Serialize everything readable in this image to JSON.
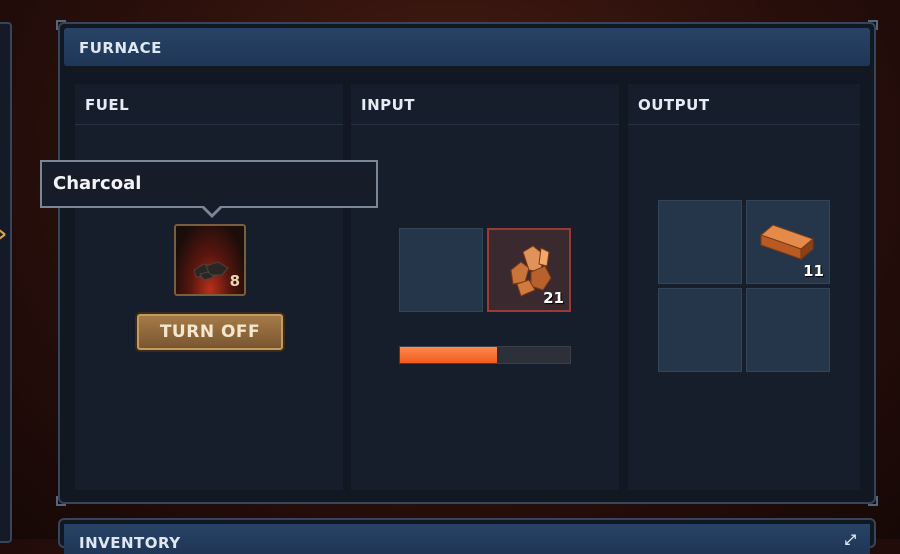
{
  "furnace": {
    "title": "FURNACE",
    "fuel": {
      "title": "FUEL",
      "item_name": "Charcoal",
      "item_quantity": "8",
      "icon": "charcoal-icon",
      "turn_off_label": "TURN OFF"
    },
    "input": {
      "title": "INPUT",
      "item_quantity": "21",
      "icon": "copper-ore-icon",
      "progress_fraction": 0.57
    },
    "output": {
      "title": "OUTPUT",
      "item_quantity": "11",
      "icon": "copper-ingot-icon"
    }
  },
  "inventory": {
    "title": "INVENTORY",
    "expand_icon": "expand-icon"
  },
  "colors": {
    "accent": "#e8a23a",
    "header_blue": "#284366",
    "progress": "#f26a2a",
    "button": "#8e6a3e"
  }
}
